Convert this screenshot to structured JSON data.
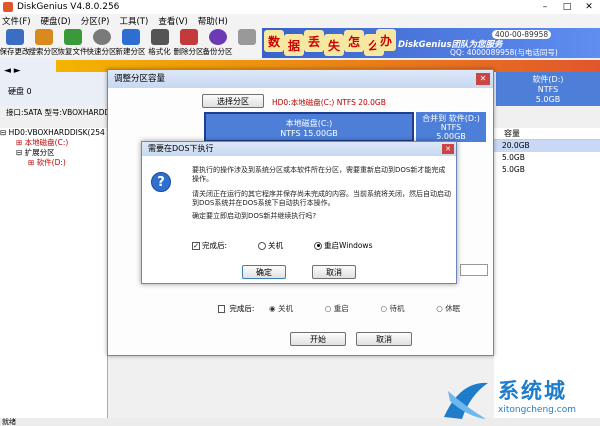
{
  "app": {
    "title": "DiskGenius V4.8.0.256",
    "menu": [
      "文件(F)",
      "硬盘(D)",
      "分区(P)",
      "工具(T)",
      "查看(V)",
      "帮助(H)"
    ],
    "toolbar": [
      {
        "label": "保存更改",
        "icon": "save-icon",
        "color": "#3b6dc4"
      },
      {
        "label": "搜索分区",
        "icon": "search-partition-icon",
        "color": "#d88a1c"
      },
      {
        "label": "恢复文件",
        "icon": "recover-file-icon",
        "color": "#3a9a3a"
      },
      {
        "label": "快速分区",
        "icon": "quick-partition-icon",
        "color": "#7a7a7a"
      },
      {
        "label": "新建分区",
        "icon": "new-partition-icon",
        "color": "#2d6fd1"
      },
      {
        "label": "格式化",
        "icon": "format-icon",
        "color": "#555555"
      },
      {
        "label": "删除分区",
        "icon": "delete-partition-icon",
        "color": "#c43a3a"
      },
      {
        "label": "备份分区",
        "icon": "backup-partition-icon",
        "color": "#6c3bb4"
      },
      {
        "label": "",
        "icon": "misc-icon",
        "color": "#999999"
      }
    ],
    "banner": {
      "chars": [
        "数",
        "据",
        "丢",
        "失",
        "怎",
        "么",
        "办"
      ],
      "brand": "DiskGenius团队为您服务",
      "qq": "QQ: 4000089958(与电话同号)",
      "phone": "400-00-89958"
    },
    "disk_nav": "◄ ►",
    "disk_label": "硬盘 0",
    "interface": "接口:SATA   型号:VBOXHARDDISK",
    "partition_d": {
      "name": "软件(D:)",
      "fs": "NTFS",
      "size": "5.0GB"
    },
    "tree": [
      "HD0:VBOXHARDDISK(254",
      "本地磁盘(C:)",
      "扩展分区",
      "软件(D:)"
    ],
    "right_panel": {
      "header": "容量",
      "rows": [
        "20.0GB",
        "5.0GB",
        "5.0GB"
      ]
    },
    "status": "就绪"
  },
  "resize_dialog": {
    "title": "调整分区容量",
    "select_btn": "选择分区",
    "disk_label": "HD0:本地磁盘(C:) NTFS 20.0GB",
    "part_c": {
      "name": "本地磁盘(C:)",
      "fs": "NTFS 15.00GB"
    },
    "part_merge": {
      "name": "合并到 软件(D:)",
      "fs": "NTFS",
      "size": "5.00GB"
    },
    "after_label": "完成后:",
    "options": [
      "关机",
      "重启",
      "待机",
      "休眠"
    ],
    "start_btn": "开始",
    "cancel_btn": "取消"
  },
  "confirm_dialog": {
    "title": "需要在DOS下执行",
    "msg1": "要执行的操作涉及到系统分区或本软件所在分区，需要重新启动到DOS新才能完成操作。",
    "msg2": "请关闭正在运行的其它程序并保存尚未完成的内容。当前系统将关闭，然后自动启动到DOS系统并在DOS系统下自动执行本操作。",
    "msg3": "确定要立即启动到DOS新并继续执行吗?",
    "after_label": "完成后:",
    "opt_shutdown": "关机",
    "opt_reboot": "重启Windows",
    "ok_btn": "确定",
    "cancel_btn": "取消"
  },
  "watermark": {
    "name": "系统城",
    "url": "xitongcheng.com"
  }
}
